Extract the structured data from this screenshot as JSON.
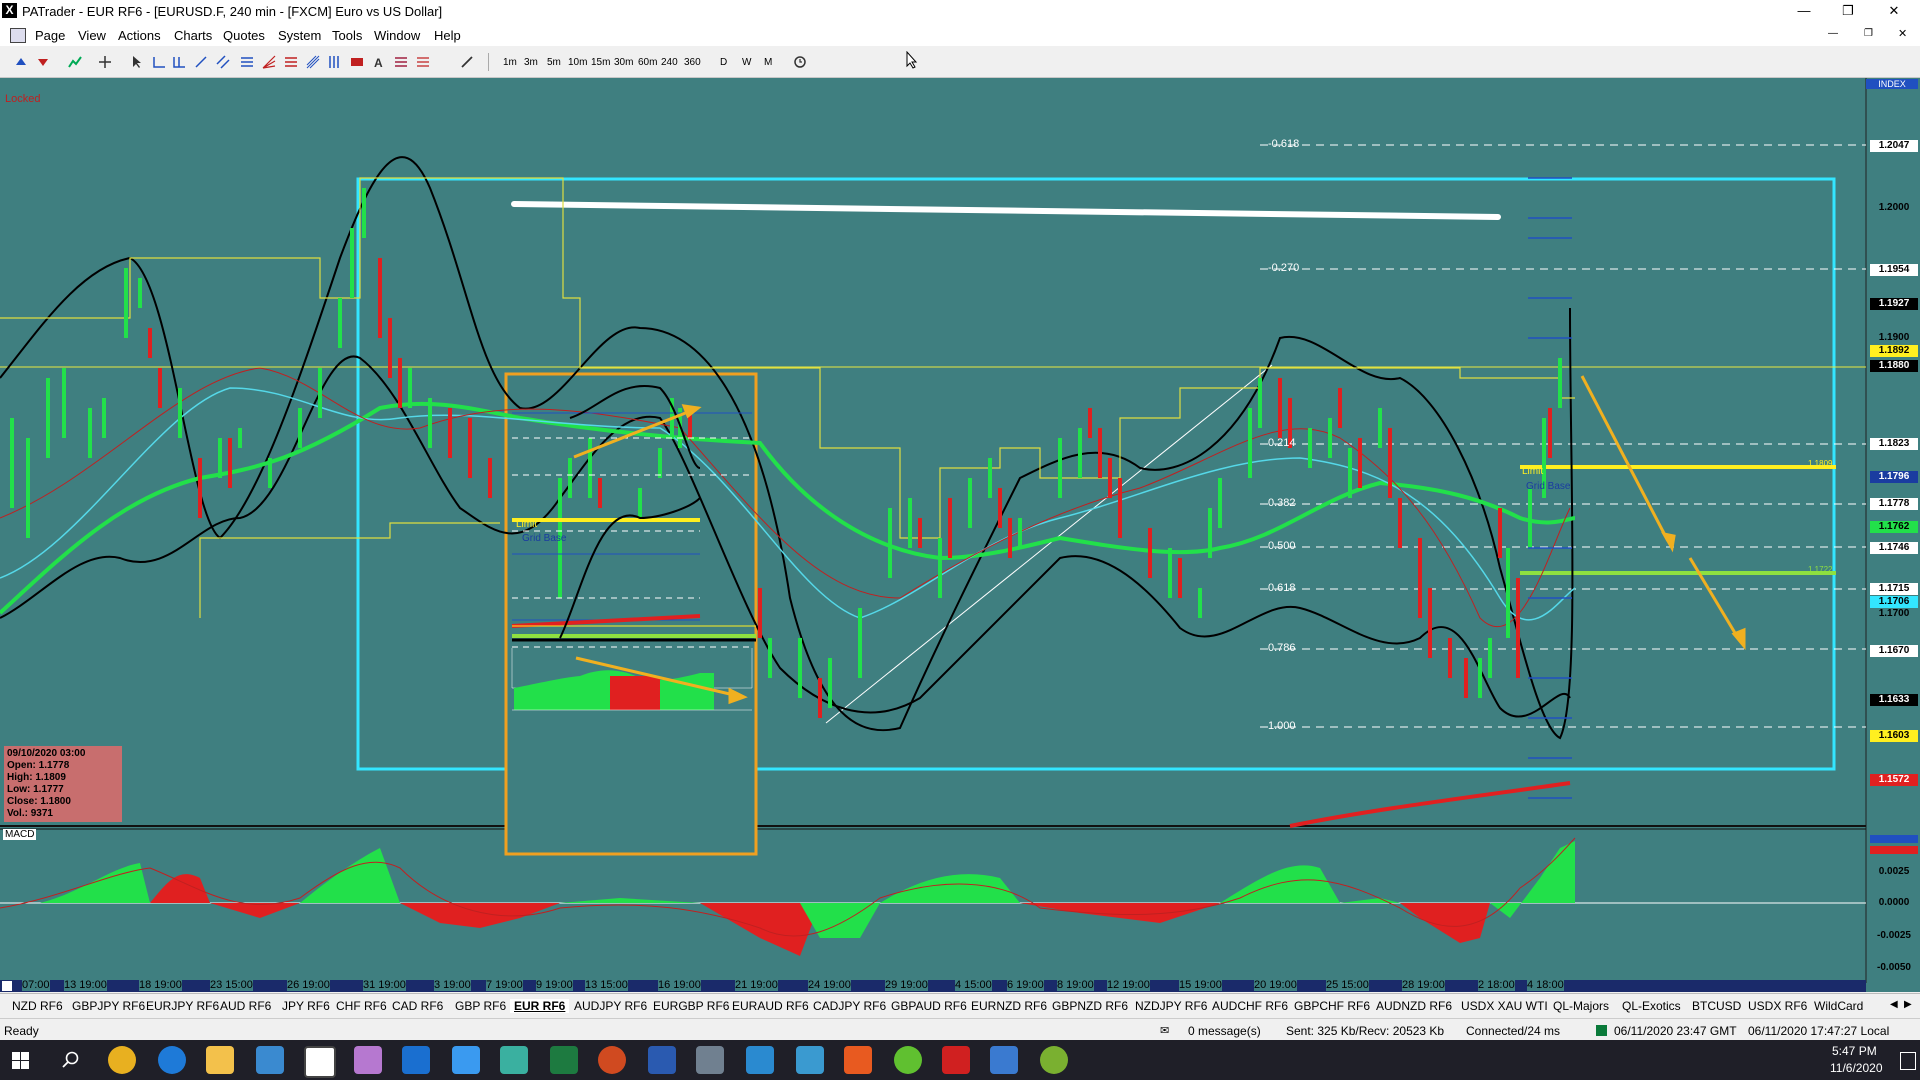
{
  "window": {
    "title": "PATrader - EUR RF6 - [EURUSD.F, 240 min - [FXCM] Euro vs US Dollar]",
    "app_icon": "X"
  },
  "menu": [
    "Page",
    "View",
    "Actions",
    "Charts",
    "Quotes",
    "System",
    "Tools",
    "Window",
    "Help"
  ],
  "timeframes": [
    "1m",
    "3m",
    "5m",
    "10m",
    "15m",
    "30m",
    "60m",
    "240",
    "360",
    "D",
    "W",
    "M"
  ],
  "chart": {
    "locked_label": "Locked",
    "index_label": "INDEX",
    "price_axis": [
      "1.2047",
      "1.2000",
      "1.1954",
      "1.1927",
      "1.1900",
      "1.1892",
      "1.1880",
      "1.1823",
      "1.1796",
      "1.1778",
      "1.1762",
      "1.1746",
      "1.1715",
      "1.1706",
      "1.1700",
      "1.1670",
      "1.1633",
      "1.1603",
      "1.1572"
    ],
    "fib_levels": [
      "-0.618",
      "-0.270",
      "0.214",
      "0.382",
      "0.500",
      "0.618",
      "0.786",
      "1.000"
    ],
    "annotations": {
      "limit": "Limit",
      "grid_base": "Grid Base",
      "level_right_1": "1.1809",
      "level_right_2": "1.1722"
    },
    "dates": [
      "07:00",
      "13 19:00",
      "18 19:00",
      "23 15:00",
      "26 19:00",
      "31 19:00",
      "3 19:00",
      "7 19:00",
      "9 19:00",
      "13 15:00",
      "16 19:00",
      "21 19:00",
      "24 19:00",
      "29 19:00",
      "4 15:00",
      "6 19:00",
      "8 19:00",
      "12 19:00",
      "15 19:00",
      "20 19:00",
      "25 15:00",
      "28 19:00",
      "2 18:00",
      "4 18:00"
    ],
    "info_box": {
      "date": "09/10/2020 03:00",
      "open": "Open: 1.1778",
      "high": "High: 1.1809",
      "low": "Low: 1.1777",
      "close": "Close: 1.1800",
      "vol": "Vol.: 9371"
    },
    "macd_label": "MACD",
    "macd_axis": [
      "0.0025",
      "0.0000",
      "-0.0025",
      "-0.0050"
    ],
    "colors": {
      "background": "#3f7f80",
      "cyan_box": "#33e6ff",
      "orange_box": "#f0a020",
      "up_bar": "#22e04a",
      "down_bar": "#e02020"
    }
  },
  "tabs": [
    "NZD RF6",
    "GBPJPY RF6",
    "EURJPY RF6",
    "AUD RF6",
    "JPY RF6",
    "CHF RF6",
    "CAD RF6",
    "GBP RF6",
    "EUR RF6",
    "AUDJPY RF6",
    "EURGBP RF6",
    "EURAUD RF6",
    "CADJPY RF6",
    "GBPAUD RF6",
    "EURNZD RF6",
    "GBPNZD RF6",
    "NZDJPY RF6",
    "AUDCHF RF6",
    "GBPCHF RF6",
    "AUDNZD RF6",
    "USDX XAU WTI",
    "QL-Majors",
    "QL-Exotics",
    "BTCUSD",
    "USDX RF6",
    "WildCard"
  ],
  "active_tab": "EUR RF6",
  "status": {
    "ready": "Ready",
    "messages": "0 message(s)",
    "sent": "Sent: 325 Kb/Recv: 20523 Kb",
    "connected": "Connected/24 ms",
    "gmt": "06/11/2020 23:47 GMT",
    "local": "06/11/2020 17:47:27 Local"
  },
  "taskbar": {
    "time": "5:47 PM",
    "date": "11/6/2020"
  }
}
